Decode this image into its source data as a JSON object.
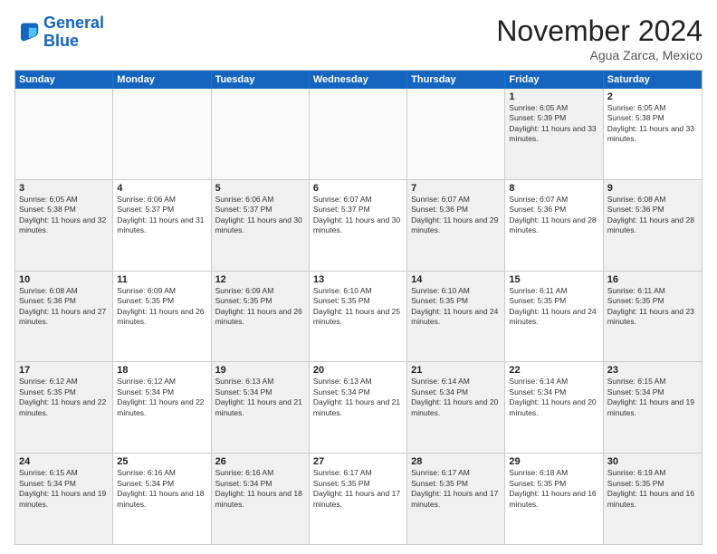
{
  "logo": {
    "line1": "General",
    "line2": "Blue"
  },
  "title": "November 2024",
  "location": "Agua Zarca, Mexico",
  "days": [
    "Sunday",
    "Monday",
    "Tuesday",
    "Wednesday",
    "Thursday",
    "Friday",
    "Saturday"
  ],
  "rows": [
    [
      {
        "day": "",
        "text": "",
        "empty": true
      },
      {
        "day": "",
        "text": "",
        "empty": true
      },
      {
        "day": "",
        "text": "",
        "empty": true
      },
      {
        "day": "",
        "text": "",
        "empty": true
      },
      {
        "day": "",
        "text": "",
        "empty": true
      },
      {
        "day": "1",
        "text": "Sunrise: 6:05 AM\nSunset: 5:39 PM\nDaylight: 11 hours and 33 minutes.",
        "shaded": true
      },
      {
        "day": "2",
        "text": "Sunrise: 6:05 AM\nSunset: 5:38 PM\nDaylight: 11 hours and 33 minutes.",
        "shaded": false
      }
    ],
    [
      {
        "day": "3",
        "text": "Sunrise: 6:05 AM\nSunset: 5:38 PM\nDaylight: 11 hours and 32 minutes.",
        "shaded": true
      },
      {
        "day": "4",
        "text": "Sunrise: 6:06 AM\nSunset: 5:37 PM\nDaylight: 11 hours and 31 minutes.",
        "shaded": false
      },
      {
        "day": "5",
        "text": "Sunrise: 6:06 AM\nSunset: 5:37 PM\nDaylight: 11 hours and 30 minutes.",
        "shaded": true
      },
      {
        "day": "6",
        "text": "Sunrise: 6:07 AM\nSunset: 5:37 PM\nDaylight: 11 hours and 30 minutes.",
        "shaded": false
      },
      {
        "day": "7",
        "text": "Sunrise: 6:07 AM\nSunset: 5:36 PM\nDaylight: 11 hours and 29 minutes.",
        "shaded": true
      },
      {
        "day": "8",
        "text": "Sunrise: 6:07 AM\nSunset: 5:36 PM\nDaylight: 11 hours and 28 minutes.",
        "shaded": false
      },
      {
        "day": "9",
        "text": "Sunrise: 6:08 AM\nSunset: 5:36 PM\nDaylight: 11 hours and 28 minutes.",
        "shaded": true
      }
    ],
    [
      {
        "day": "10",
        "text": "Sunrise: 6:08 AM\nSunset: 5:36 PM\nDaylight: 11 hours and 27 minutes.",
        "shaded": true
      },
      {
        "day": "11",
        "text": "Sunrise: 6:09 AM\nSunset: 5:35 PM\nDaylight: 11 hours and 26 minutes.",
        "shaded": false
      },
      {
        "day": "12",
        "text": "Sunrise: 6:09 AM\nSunset: 5:35 PM\nDaylight: 11 hours and 26 minutes.",
        "shaded": true
      },
      {
        "day": "13",
        "text": "Sunrise: 6:10 AM\nSunset: 5:35 PM\nDaylight: 11 hours and 25 minutes.",
        "shaded": false
      },
      {
        "day": "14",
        "text": "Sunrise: 6:10 AM\nSunset: 5:35 PM\nDaylight: 11 hours and 24 minutes.",
        "shaded": true
      },
      {
        "day": "15",
        "text": "Sunrise: 6:11 AM\nSunset: 5:35 PM\nDaylight: 11 hours and 24 minutes.",
        "shaded": false
      },
      {
        "day": "16",
        "text": "Sunrise: 6:11 AM\nSunset: 5:35 PM\nDaylight: 11 hours and 23 minutes.",
        "shaded": true
      }
    ],
    [
      {
        "day": "17",
        "text": "Sunrise: 6:12 AM\nSunset: 5:35 PM\nDaylight: 11 hours and 22 minutes.",
        "shaded": true
      },
      {
        "day": "18",
        "text": "Sunrise: 6:12 AM\nSunset: 5:34 PM\nDaylight: 11 hours and 22 minutes.",
        "shaded": false
      },
      {
        "day": "19",
        "text": "Sunrise: 6:13 AM\nSunset: 5:34 PM\nDaylight: 11 hours and 21 minutes.",
        "shaded": true
      },
      {
        "day": "20",
        "text": "Sunrise: 6:13 AM\nSunset: 5:34 PM\nDaylight: 11 hours and 21 minutes.",
        "shaded": false
      },
      {
        "day": "21",
        "text": "Sunrise: 6:14 AM\nSunset: 5:34 PM\nDaylight: 11 hours and 20 minutes.",
        "shaded": true
      },
      {
        "day": "22",
        "text": "Sunrise: 6:14 AM\nSunset: 5:34 PM\nDaylight: 11 hours and 20 minutes.",
        "shaded": false
      },
      {
        "day": "23",
        "text": "Sunrise: 6:15 AM\nSunset: 5:34 PM\nDaylight: 11 hours and 19 minutes.",
        "shaded": true
      }
    ],
    [
      {
        "day": "24",
        "text": "Sunrise: 6:15 AM\nSunset: 5:34 PM\nDaylight: 11 hours and 19 minutes.",
        "shaded": true
      },
      {
        "day": "25",
        "text": "Sunrise: 6:16 AM\nSunset: 5:34 PM\nDaylight: 11 hours and 18 minutes.",
        "shaded": false
      },
      {
        "day": "26",
        "text": "Sunrise: 6:16 AM\nSunset: 5:34 PM\nDaylight: 11 hours and 18 minutes.",
        "shaded": true
      },
      {
        "day": "27",
        "text": "Sunrise: 6:17 AM\nSunset: 5:35 PM\nDaylight: 11 hours and 17 minutes.",
        "shaded": false
      },
      {
        "day": "28",
        "text": "Sunrise: 6:17 AM\nSunset: 5:35 PM\nDaylight: 11 hours and 17 minutes.",
        "shaded": true
      },
      {
        "day": "29",
        "text": "Sunrise: 6:18 AM\nSunset: 5:35 PM\nDaylight: 11 hours and 16 minutes.",
        "shaded": false
      },
      {
        "day": "30",
        "text": "Sunrise: 6:19 AM\nSunset: 5:35 PM\nDaylight: 11 hours and 16 minutes.",
        "shaded": true
      }
    ]
  ]
}
